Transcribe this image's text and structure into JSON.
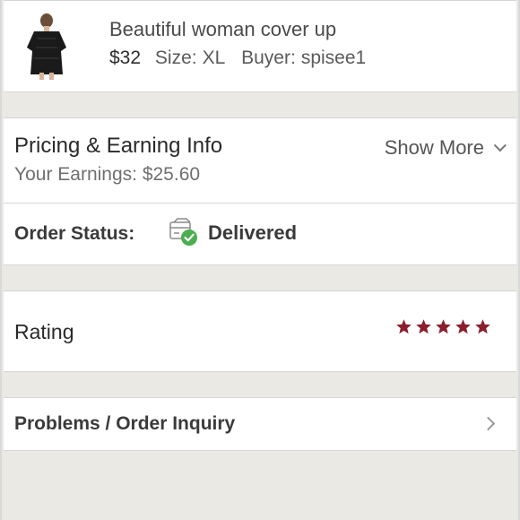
{
  "item": {
    "title": "Beautiful woman cover up",
    "price": "$32",
    "size_label": "Size:",
    "size_value": "XL",
    "buyer_label": "Buyer:",
    "buyer_value": "spisee1",
    "thumbnail_icon": "product-photo-icon"
  },
  "pricing": {
    "title": "Pricing & Earning Info",
    "earnings": "Your Earnings: $25.60",
    "show_more": "Show More"
  },
  "order_status": {
    "label": "Order Status:",
    "value": "Delivered",
    "icon": "delivered-box-icon",
    "check_color": "#4cae4f"
  },
  "rating": {
    "label": "Rating",
    "stars": 5,
    "max_stars": 5,
    "star_color": "#8b1e2d"
  },
  "problems": {
    "label": "Problems / Order Inquiry"
  }
}
